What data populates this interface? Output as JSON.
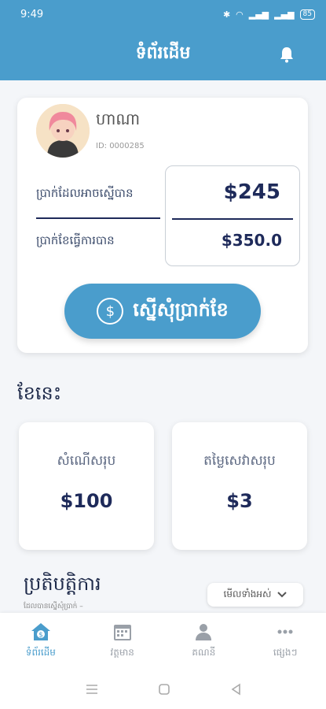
{
  "status_bar": {
    "time": "9:49",
    "battery": "85"
  },
  "app_bar": {
    "title": "ទំព័រដើម"
  },
  "profile": {
    "name": "ហាណា",
    "id_text": "ID: 0000285",
    "label_available": "ប្រាក់ដែលអាចស្នើបាន",
    "label_earned": "ប្រាក់ខែធ្វើការបាន",
    "amount_available": "$245",
    "amount_earned": "$350.0",
    "request_button": "ស្នើសុំប្រាក់ខែ"
  },
  "this_month": {
    "title": "ខែនេះ",
    "total_requested_label": "សំណើសរុប",
    "total_requested_value": "$100",
    "total_fee_label": "តម្លៃសេវាសរុប",
    "total_fee_value": "$3"
  },
  "history": {
    "title": "ប្រតិបត្តិការ",
    "subtitle": "ដែលបានស្នើសុំប្រាក់ –",
    "view_all": "មើលទាំងអស់"
  },
  "bottom_nav": [
    {
      "label": "ទំព័រដើម",
      "icon": "home-dollar-icon",
      "active": true
    },
    {
      "label": "វត្តមាន",
      "icon": "calendar-icon",
      "active": false
    },
    {
      "label": "គណនី",
      "icon": "person-icon",
      "active": false
    },
    {
      "label": "ផ្សេងៗ",
      "icon": "more-icon",
      "active": false
    }
  ],
  "colors": {
    "primary": "#4a9dcc",
    "dark_text": "#1e2a5a",
    "background": "#f4f6f9"
  }
}
